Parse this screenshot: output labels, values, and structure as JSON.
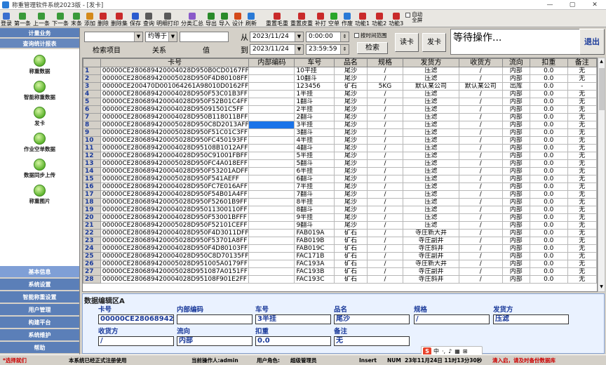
{
  "window": {
    "title": "称重管理软件系统2023版 - [发卡]",
    "min": "—",
    "max": "▢",
    "close": "✕"
  },
  "toolbar": [
    {
      "label": "登录",
      "icon": "login-icon",
      "color": "#3a6fcf"
    },
    {
      "label": "第一条",
      "icon": "first-record-icon",
      "color": "#3a9a3a"
    },
    {
      "label": "上一条",
      "icon": "prev-record-icon",
      "color": "#3a9a3a"
    },
    {
      "label": "下一条",
      "icon": "next-record-icon",
      "color": "#3a9a3a"
    },
    {
      "label": "末条",
      "icon": "last-record-icon",
      "color": "#3a9a3a"
    },
    {
      "label": "添加",
      "icon": "add-icon",
      "color": "#d48a1a"
    },
    {
      "label": "删除",
      "icon": "delete-icon",
      "color": "#c92a2a"
    },
    {
      "label": "删除集",
      "icon": "delete-set-icon",
      "color": "#c92a2a"
    },
    {
      "label": "保存",
      "icon": "save-icon",
      "color": "#2a5bcf"
    },
    {
      "label": "查询",
      "icon": "search-icon",
      "color": "#5a5a5a"
    },
    {
      "label": "明细打印",
      "icon": "print-icon",
      "color": "#5a5a5a"
    },
    {
      "label": "分类汇总",
      "icon": "summary-icon",
      "color": "#8a5ac9"
    },
    {
      "label": "导出",
      "icon": "export-icon",
      "color": "#2a8a2a"
    },
    {
      "label": "导入",
      "icon": "import-icon",
      "color": "#2a8a2a"
    },
    {
      "label": "设计",
      "icon": "design-icon",
      "color": "#d44a1a"
    },
    {
      "label": "刷新",
      "icon": "refresh-icon",
      "color": "#2a7ad6"
    },
    {
      "label": "重置毛重",
      "icon": "reset-gross-icon",
      "color": "#c92a2a"
    },
    {
      "label": "重置皮重",
      "icon": "reset-tare-icon",
      "color": "#c92a2a"
    },
    {
      "label": "补打",
      "icon": "reprint-icon",
      "color": "#c92a2a"
    },
    {
      "label": "空单",
      "icon": "empty-form-icon",
      "color": "#2aa62a"
    },
    {
      "label": "作废",
      "icon": "void-icon",
      "color": "#2a7ad6"
    },
    {
      "label": "功能1",
      "icon": "function-1-icon",
      "color": "#c92a2a"
    },
    {
      "label": "功能2",
      "icon": "function-2-icon",
      "color": "#c92a2a"
    },
    {
      "label": "功能3",
      "icon": "function-3-icon",
      "color": "#c92a2a"
    }
  ],
  "auto_fullscreen": {
    "line1": "自动",
    "line2": "全屏"
  },
  "sidebar": {
    "top_headers": [
      "计量业务",
      "查询统计报表"
    ],
    "items": [
      "称重数据",
      "智能称重数据",
      "发卡",
      "作业空单数据",
      "数据同步上传",
      "称重图片"
    ],
    "bottom_headers": [
      "基本信息",
      "系统设置",
      "智能称重设置",
      "用户管理",
      "构建平台",
      "系统维护",
      "帮助"
    ]
  },
  "query": {
    "field_select": "",
    "relation_select": "约等于",
    "value_input": "",
    "field_label": "检索项目",
    "relation_label": "关系",
    "value_label": "值",
    "from_label": "从",
    "to_label": "到",
    "from_date": "2023/11/24",
    "to_date": "2023/11/24",
    "from_time": "0:00:00",
    "to_time": "23:59:59",
    "by_time_range": "按时间范围",
    "search_button": "检索",
    "read_card_button": "读卡",
    "issue_card_button": "发卡",
    "status": "等待操作...",
    "exit_button": "退出"
  },
  "table": {
    "columns": [
      "卡号",
      "内部编码",
      "车号",
      "品名",
      "规格",
      "发货方",
      "收货方",
      "流向",
      "扣重",
      "备注"
    ],
    "rows": [
      {
        "n": "1",
        "card": "00000CE2806894200040​28D950B0CD0167FF",
        "code": "",
        "car": "10平挂",
        "product": "尾沙",
        "spec": "/",
        "sender": "压滤",
        "receiver": "/",
        "flow": "内部",
        "deduct": "0.0",
        "note": "无"
      },
      {
        "n": "2",
        "card": "",
        "code": "",
        "car": "",
        "product": "",
        "spec": "",
        "sender": "",
        "receiver": "",
        "flow": "",
        "deduct": "",
        "note": ""
      }
    ]
  },
  "editor": {
    "title": "数据编辑区A",
    "card_label": "卡号",
    "card_value": "00000CE28068942",
    "code_label": "内部编码",
    "code_value": "",
    "car_label": "车号",
    "car_value": "3半挂",
    "product_label": "品名",
    "product_value": "尾沙",
    "spec_label": "规格",
    "spec_value": "/",
    "sender_label": "发货方",
    "sender_value": "压滤",
    "receiver_label": "收货方",
    "receiver_value": "/",
    "flow_label": "流向",
    "flow_value": "内部",
    "deduct_label": "扣重",
    "deduct_value": "0.0",
    "note_label": "备注",
    "note_value": "无"
  },
  "statusbar": {
    "left": "*选择就们",
    "registered": "本系统已经正式注册使用",
    "operator": "当前操作人:admin",
    "role": "用户角色:",
    "role_value": "超级管理员",
    "insert": "Insert",
    "num": "NUM",
    "datetime": "23年11月24日 11时13分30秒",
    "warning": "清入启，请及时备份数据库"
  },
  "ime": {
    "label": "中"
  }
}
